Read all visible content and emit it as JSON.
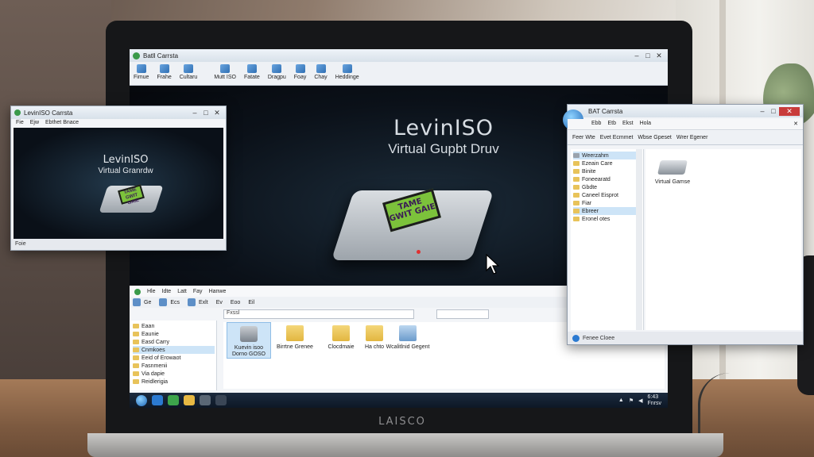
{
  "laptop": {
    "brand": "LAISCO"
  },
  "main_window": {
    "title": "Batll Carrsta",
    "toolbar": [
      {
        "label": "Fimue",
        "icon": "arrow-back-icon"
      },
      {
        "label": "Frahe",
        "icon": "document-icon"
      },
      {
        "label": "Cultaru",
        "icon": "folder-icon"
      },
      {
        "label": "Mutt ISO",
        "icon": "disc-icon"
      },
      {
        "label": "Fatate",
        "icon": "search-icon"
      },
      {
        "label": "Dragpu",
        "icon": "copy-icon"
      },
      {
        "label": "Foay",
        "icon": "image-icon"
      },
      {
        "label": "Chay",
        "icon": "edit-icon"
      },
      {
        "label": "Heddinge",
        "icon": "help-icon"
      }
    ],
    "brand_title": "LevinISO",
    "brand_subtitle": "Virtual Gupbt Druv",
    "drive_label": "TAME GWIT GAIE"
  },
  "explorer": {
    "menu": [
      "Hle",
      "Idte",
      "Latt",
      "Fay",
      "Hanwe"
    ],
    "toolbar": [
      "Ge",
      "Ecs",
      "Exlt",
      "Ev",
      "Eoo",
      "Eil"
    ],
    "address": "Fxssl",
    "nav": [
      {
        "label": "Eaan",
        "selected": false
      },
      {
        "label": "Eaunie",
        "selected": false
      },
      {
        "label": "Easd Carry",
        "selected": false
      },
      {
        "label": "Cnmkoes",
        "selected": true
      },
      {
        "label": "Eeid of Erowaot",
        "selected": false
      },
      {
        "label": "Fasnmenii",
        "selected": false
      },
      {
        "label": "Via dapie",
        "selected": false
      },
      {
        "label": "Reidlerigia",
        "selected": false
      }
    ],
    "files": [
      {
        "label": "Kuevin isoo Dorno GOSO",
        "type": "drive",
        "selected": true
      },
      {
        "label": "Birrtne Grenee",
        "type": "folder",
        "selected": false
      },
      {
        "label": "Clocdmaie",
        "type": "folder",
        "selected": false
      },
      {
        "label": "Ha chto",
        "type": "folder",
        "selected": false
      },
      {
        "label": "Wcalitlnid Gegent",
        "type": "pc",
        "selected": false
      }
    ]
  },
  "taskbar": {
    "clock_time": "6:43",
    "clock_date": "Fnrsv"
  },
  "left_window": {
    "title": "LevinISO Carrsta",
    "menu": [
      "Fie",
      "Ejw",
      "Ebthet Bnace"
    ],
    "brand_title": "LevinISO",
    "brand_subtitle": "Virtual Granrdw",
    "drive_label": "TAME GWIT GAIE",
    "status": "Foie"
  },
  "right_window": {
    "title": "BAT Carrsta",
    "menu": [
      "Ebb",
      "Etb",
      "Ekst",
      "Hola"
    ],
    "toolbar": [
      "Feer Wte",
      "Evet Ecmmet",
      "Wbse Gpeset",
      "Wrer Egener"
    ],
    "nav": [
      {
        "label": "Weerzahm",
        "selected": true
      },
      {
        "label": "Ezeain Care",
        "selected": false
      },
      {
        "label": "Binite",
        "selected": false
      },
      {
        "label": "Foneearatd",
        "selected": false
      },
      {
        "label": "Gbdte",
        "selected": false
      },
      {
        "label": "Caneel Eisprot",
        "selected": false
      },
      {
        "label": "Fiar",
        "selected": false
      },
      {
        "label": "Ebreer",
        "selected": true
      },
      {
        "label": "Eronel otes",
        "selected": false
      }
    ],
    "item_label": "Virtual Gamse",
    "status": "Fenee Cloee"
  }
}
